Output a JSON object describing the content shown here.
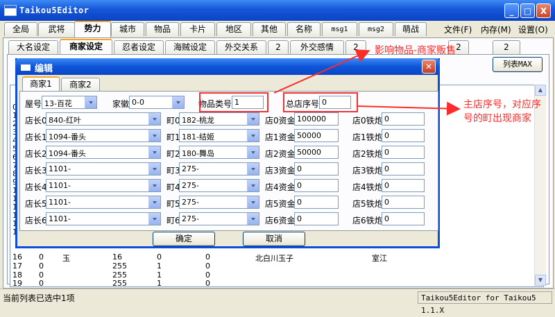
{
  "window": {
    "title": "Taikou5Editor",
    "min": "_",
    "max": "□",
    "close": "X"
  },
  "main_tabs": [
    "全局",
    "武将",
    "势力",
    "城市",
    "物品",
    "卡片",
    "地区",
    "其他",
    "名称",
    "msg1",
    "msg2",
    "萌战"
  ],
  "menu": [
    "文件(F)",
    "内存(M)",
    "设置(O)"
  ],
  "sub_tabs": [
    "大名设定",
    "商家设定",
    "忍者设定",
    "海贼设定",
    "外交关系",
    "2",
    "外交感情",
    "2",
    "2",
    "2"
  ],
  "list_button": "列表MAX",
  "list_rows": [
    {
      "n": "16",
      "a": "0",
      "b": "玉",
      "c": "16",
      "d": "0",
      "e": "0",
      "f": "北白川玉子",
      "g": "室江"
    },
    {
      "n": "17",
      "a": "0",
      "b": "",
      "c": "255",
      "d": "1",
      "e": "0",
      "f": "",
      "g": ""
    },
    {
      "n": "18",
      "a": "0",
      "b": "",
      "c": "255",
      "d": "1",
      "e": "0",
      "f": "",
      "g": ""
    },
    {
      "n": "19",
      "a": "0",
      "b": "",
      "c": "255",
      "d": "1",
      "e": "0",
      "f": "",
      "g": ""
    }
  ],
  "left_nums": [
    "0",
    "1",
    "2",
    "3",
    "4",
    "5",
    "6",
    "7",
    "8",
    "9",
    "10",
    "11",
    "12",
    "13",
    "14",
    "15"
  ],
  "status": {
    "left": "当前列表已选中1项",
    "right": "Taikou5Editor for Taikou5 1.1.X"
  },
  "dialog": {
    "title": "编辑",
    "tabs": [
      "商家1",
      "商家2"
    ],
    "row0": {
      "wu_label": "屋号",
      "wu_value": "13-百花",
      "jia_label": "家徽",
      "jia_value": "0-0",
      "item_label": "物品类号",
      "item_value": "1",
      "total_label": "总店序号",
      "total_value": "0"
    },
    "rows": [
      {
        "zl": "店长0",
        "zv": "840-红叶",
        "tl": "町0",
        "tv": "182-桃龙",
        "ml": "店0资金",
        "mv": "100000",
        "gl": "店0铁炮",
        "gv": "0"
      },
      {
        "zl": "店长1",
        "zv": "1094-番头",
        "tl": "町1",
        "tv": "181-结姬",
        "ml": "店1资金",
        "mv": "50000",
        "gl": "店1铁炮",
        "gv": "0"
      },
      {
        "zl": "店长2",
        "zv": "1094-番头",
        "tl": "町2",
        "tv": "180-舞岛",
        "ml": "店2资金",
        "mv": "50000",
        "gl": "店2铁炮",
        "gv": "0"
      },
      {
        "zl": "店长3",
        "zv": "1101-",
        "tl": "町3",
        "tv": "275-",
        "ml": "店3资金",
        "mv": "0",
        "gl": "店3铁炮",
        "gv": "0"
      },
      {
        "zl": "店长4",
        "zv": "1101-",
        "tl": "町4",
        "tv": "275-",
        "ml": "店4资金",
        "mv": "0",
        "gl": "店4铁炮",
        "gv": "0"
      },
      {
        "zl": "店长5",
        "zv": "1101-",
        "tl": "町5",
        "tv": "275-",
        "ml": "店5资金",
        "mv": "0",
        "gl": "店5铁炮",
        "gv": "0"
      },
      {
        "zl": "店长6",
        "zv": "1101-",
        "tl": "町6",
        "tv": "275-",
        "ml": "店6资金",
        "mv": "0",
        "gl": "店6铁炮",
        "gv": "0"
      }
    ],
    "ok": "确定",
    "cancel": "取消"
  },
  "annotations": {
    "a1": "影响物品-商家贩售",
    "a2_line1": "主店序号，对应序",
    "a2_line2": "号的町出现商家"
  },
  "colors": {
    "accent_red": "#ff2a2a",
    "xp_blue": "#0a4fd6",
    "tab_orange": "#f5a623"
  }
}
